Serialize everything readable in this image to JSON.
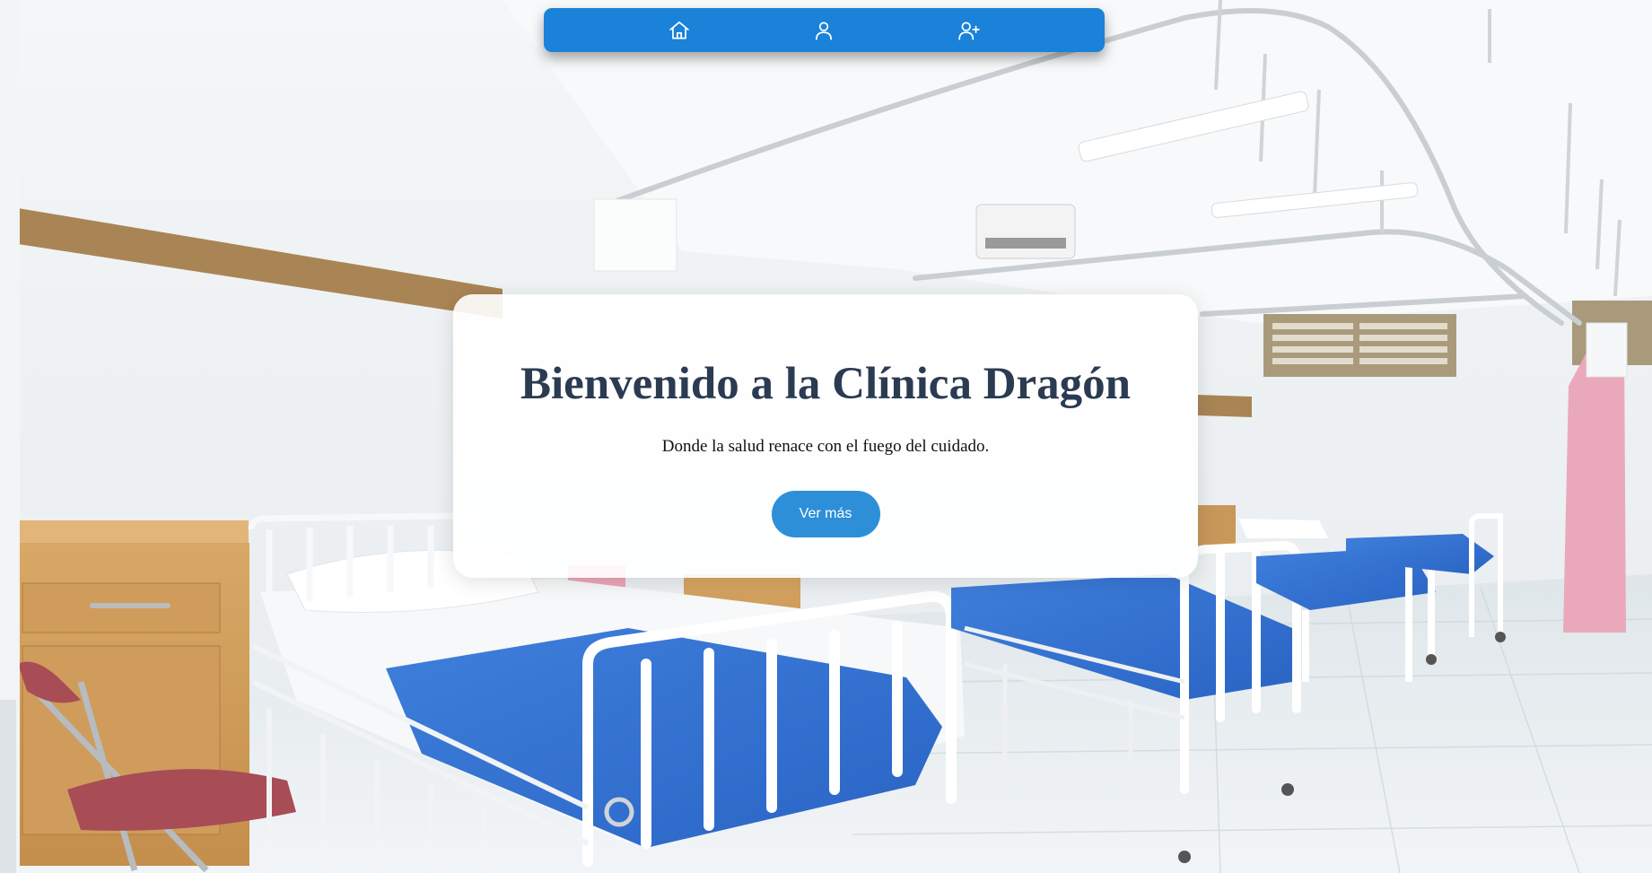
{
  "navbar": {
    "items": [
      {
        "icon": "home-icon"
      },
      {
        "icon": "user-icon"
      },
      {
        "icon": "user-plus-icon"
      }
    ],
    "color": "#1a82d8"
  },
  "hero": {
    "title": "Bienvenido a la Clínica Dragón",
    "subtitle": "Donde la salud renace con el fuego del cuidado.",
    "button_label": "Ver más",
    "title_color": "#2a3b52",
    "button_color": "#2e8fd9"
  }
}
